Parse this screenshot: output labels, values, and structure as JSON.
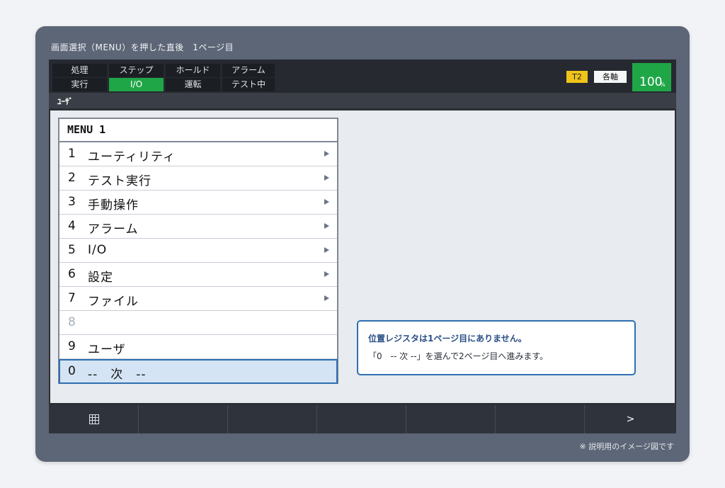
{
  "caption": "画面選択（MENU）を押した直後　1ページ目",
  "footnote": "※ 説明用のイメージ図です",
  "status": {
    "buttons_top": [
      "処理",
      "ステップ",
      "ホールド",
      "アラーム"
    ],
    "buttons_bottom": [
      "実行",
      "I/O",
      "運転",
      "テスト中"
    ],
    "active": "I/O",
    "tool": "T2",
    "axes": "各軸",
    "speed": "100",
    "speed_unit": "%"
  },
  "user_bar": "ﾕｰｻﾞ",
  "menu": {
    "title": "MENU 1",
    "items": [
      {
        "num": "1",
        "label": "ユーティリティ",
        "submenu": true
      },
      {
        "num": "2",
        "label": "テスト実行",
        "submenu": true
      },
      {
        "num": "3",
        "label": "手動操作",
        "submenu": true
      },
      {
        "num": "4",
        "label": "アラーム",
        "submenu": true
      },
      {
        "num": "5",
        "label": "I/O",
        "submenu": true
      },
      {
        "num": "6",
        "label": "設定",
        "submenu": true
      },
      {
        "num": "7",
        "label": "ファイル",
        "submenu": true
      },
      {
        "num": "8",
        "label": "",
        "submenu": false,
        "disabled": true
      },
      {
        "num": "9",
        "label": "ユーザ",
        "submenu": false
      },
      {
        "num": "0",
        "label": "--　次　--",
        "submenu": false,
        "selected": true
      }
    ]
  },
  "info": {
    "line1": "位置レジスタは1ページ目にありません。",
    "line2": "「0　-- 次 --」を選んで2ページ目へ進みます。"
  },
  "function_keys": {
    "first_icon": "grid-icon",
    "last_label": ">"
  },
  "colors": {
    "active_green": "#1fa647",
    "tool_yellow": "#f0c419",
    "select_blue": "#2f6fb0"
  }
}
